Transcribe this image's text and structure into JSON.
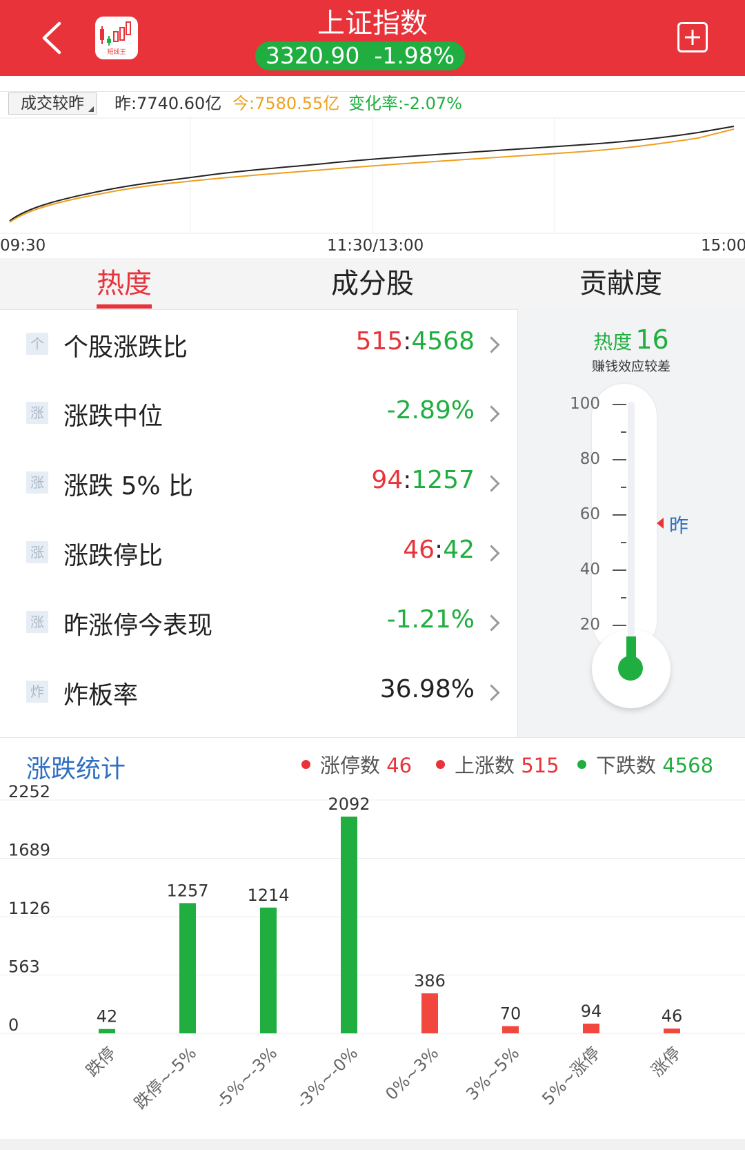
{
  "header": {
    "title": "上证指数",
    "index_value": "3320.90",
    "index_change": "-1.98%",
    "logo_text": "短线王"
  },
  "volume": {
    "dropdown_label": "成交较昨",
    "yesterday": "昨:7740.60亿",
    "today": "今:7580.55亿",
    "change_rate": "变化率:-2.07%",
    "time_labels": [
      "09:30",
      "11:30/13:00",
      "15:00"
    ]
  },
  "tabs": [
    {
      "label": "热度",
      "active": true
    },
    {
      "label": "成分股",
      "active": false
    },
    {
      "label": "贡献度",
      "active": false
    }
  ],
  "stats": [
    {
      "icon": "个",
      "label": "个股涨跌比",
      "left": "515",
      "sep": ":",
      "right": "4568"
    },
    {
      "icon": "涨",
      "label": "涨跌中位",
      "value": "-2.89%",
      "color": "green"
    },
    {
      "icon": "涨",
      "label": "涨跌 5% 比",
      "left": "94",
      "sep": ":",
      "right": "1257"
    },
    {
      "icon": "涨",
      "label": "涨跌停比",
      "left": "46",
      "sep": ":",
      "right": "42"
    },
    {
      "icon": "涨",
      "label": "昨涨停今表现",
      "value": "-1.21%",
      "color": "green"
    },
    {
      "icon": "炸",
      "label": "炸板率",
      "value": "36.98%",
      "color": "dark"
    }
  ],
  "thermometer": {
    "title": "热度",
    "value": "16",
    "level": 16,
    "subtitle": "赚钱效应较差",
    "scale": [
      "100",
      "80",
      "60",
      "40",
      "20"
    ],
    "marker_label": "昨",
    "yesterday_level": 57
  },
  "distribution": {
    "title": "涨跌统计",
    "legend": [
      {
        "label": "涨停数",
        "value": "46",
        "color": "#e8333a"
      },
      {
        "label": "上涨数",
        "value": "515",
        "color": "#e8333a"
      },
      {
        "label": "下跌数",
        "value": "4568",
        "color": "#1fae3f"
      }
    ]
  },
  "chart_data": {
    "type": "bar",
    "categories": [
      "跌停",
      "跌停~-5%",
      "-5%~-3%",
      "-3%~-0%",
      "0%~3%",
      "3%~5%",
      "5%~涨停",
      "涨停"
    ],
    "values": [
      42,
      1257,
      1214,
      2092,
      386,
      70,
      94,
      46
    ],
    "colors": [
      "#1fae3f",
      "#1fae3f",
      "#1fae3f",
      "#1fae3f",
      "#f2473f",
      "#f2473f",
      "#f2473f",
      "#f2473f"
    ],
    "yticks": [
      "2252",
      "1689",
      "1126",
      "563",
      "0"
    ],
    "ylim": [
      0,
      2252
    ],
    "grid": true
  },
  "colors": {
    "brand_red": "#e8333a",
    "up_red": "#e8333a",
    "down_green": "#1fae3f",
    "title_blue": "#2f6fc0",
    "today_orange": "#eea020"
  }
}
